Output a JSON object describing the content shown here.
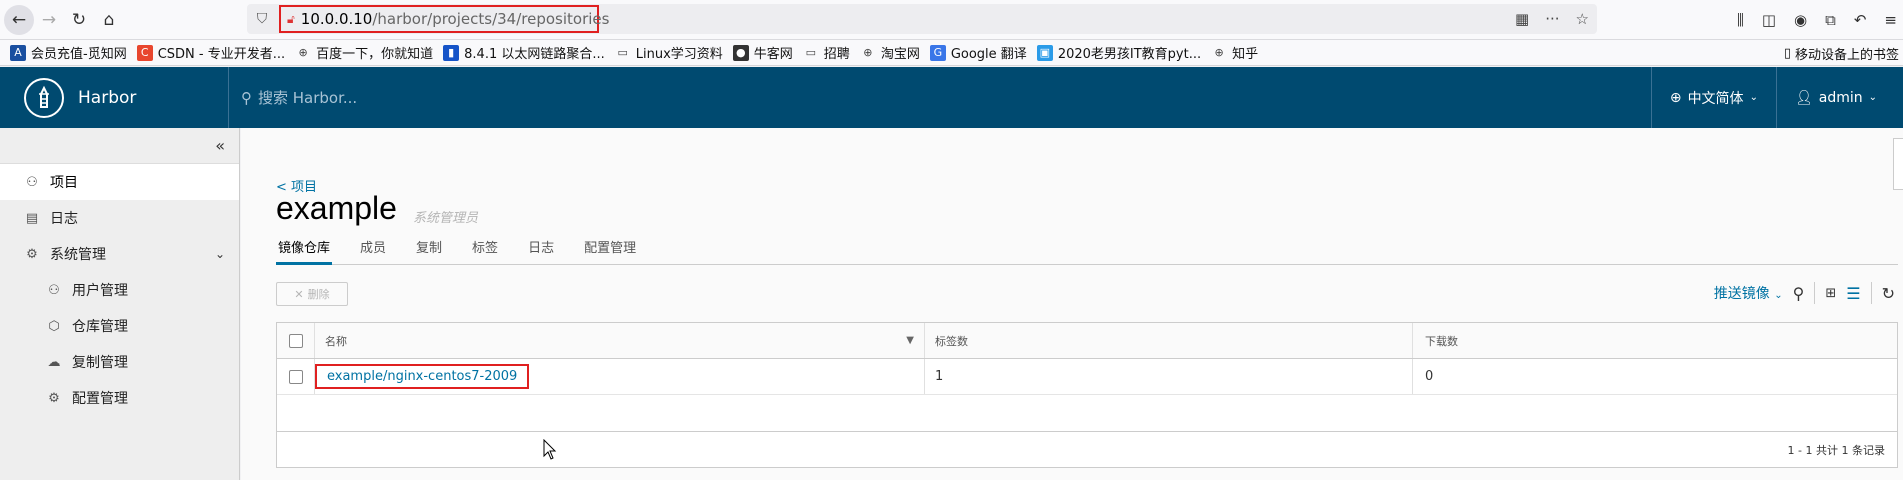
{
  "browser": {
    "url_host": "10.0.0.10",
    "url_path": "/harbor/projects/34/repositories"
  },
  "bookmarks": [
    {
      "label": "会员充值-觅知网",
      "color": "#1a4fa0",
      "glyph": "A"
    },
    {
      "label": "CSDN - 专业开发者...",
      "color": "#e8462e",
      "glyph": "C"
    },
    {
      "label": "百度一下，你就知道",
      "color": "#ffffff",
      "glyph": "⊕"
    },
    {
      "label": "8.4.1 以太网链路聚合...",
      "color": "#1654c8",
      "glyph": "▮"
    },
    {
      "label": "Linux学习资料",
      "color": "#ffffff",
      "glyph": "▭"
    },
    {
      "label": "牛客网",
      "color": "#333333",
      "glyph": "●"
    },
    {
      "label": "招聘",
      "color": "#ffffff",
      "glyph": "▭"
    },
    {
      "label": "淘宝网",
      "color": "#ffffff",
      "glyph": "⊕"
    },
    {
      "label": "Google 翻译",
      "color": "#3a76e8",
      "glyph": "G"
    },
    {
      "label": "2020老男孩IT教育pyt...",
      "color": "#2b9be8",
      "glyph": "▣"
    },
    {
      "label": "知乎",
      "color": "#ffffff",
      "glyph": "⊕"
    }
  ],
  "mobile_bookmarks": "移动设备上的书签",
  "header": {
    "brand": "Harbor",
    "search_placeholder": "搜索 Harbor...",
    "language": "中文简体",
    "user": "admin"
  },
  "sidebar": {
    "items": [
      {
        "label": "项目",
        "icon": "projects-icon",
        "glyph": "⚇"
      },
      {
        "label": "日志",
        "icon": "logs-icon",
        "glyph": "▤"
      },
      {
        "label": "系统管理",
        "icon": "admin-icon",
        "glyph": "⚙"
      },
      {
        "label": "用户管理",
        "icon": "users-icon",
        "glyph": "⚇"
      },
      {
        "label": "仓库管理",
        "icon": "registry-icon",
        "glyph": "⬡"
      },
      {
        "label": "复制管理",
        "icon": "replication-icon",
        "glyph": "☁"
      },
      {
        "label": "配置管理",
        "icon": "config-icon",
        "glyph": "⚙"
      }
    ]
  },
  "project": {
    "back_label": "< 项目",
    "name": "example",
    "role": "系统管理员"
  },
  "tabs": [
    "镜像仓库",
    "成员",
    "复制",
    "标签",
    "日志",
    "配置管理"
  ],
  "toolbar": {
    "delete_label": "删除",
    "push_label": "推送镜像"
  },
  "grid": {
    "columns": [
      "名称",
      "标签数",
      "下载数"
    ],
    "rows": [
      {
        "name": "example/nginx-centos7-2009",
        "tags": "1",
        "pulls": "0"
      }
    ],
    "footer": "1 - 1 共计 1 条记录"
  }
}
